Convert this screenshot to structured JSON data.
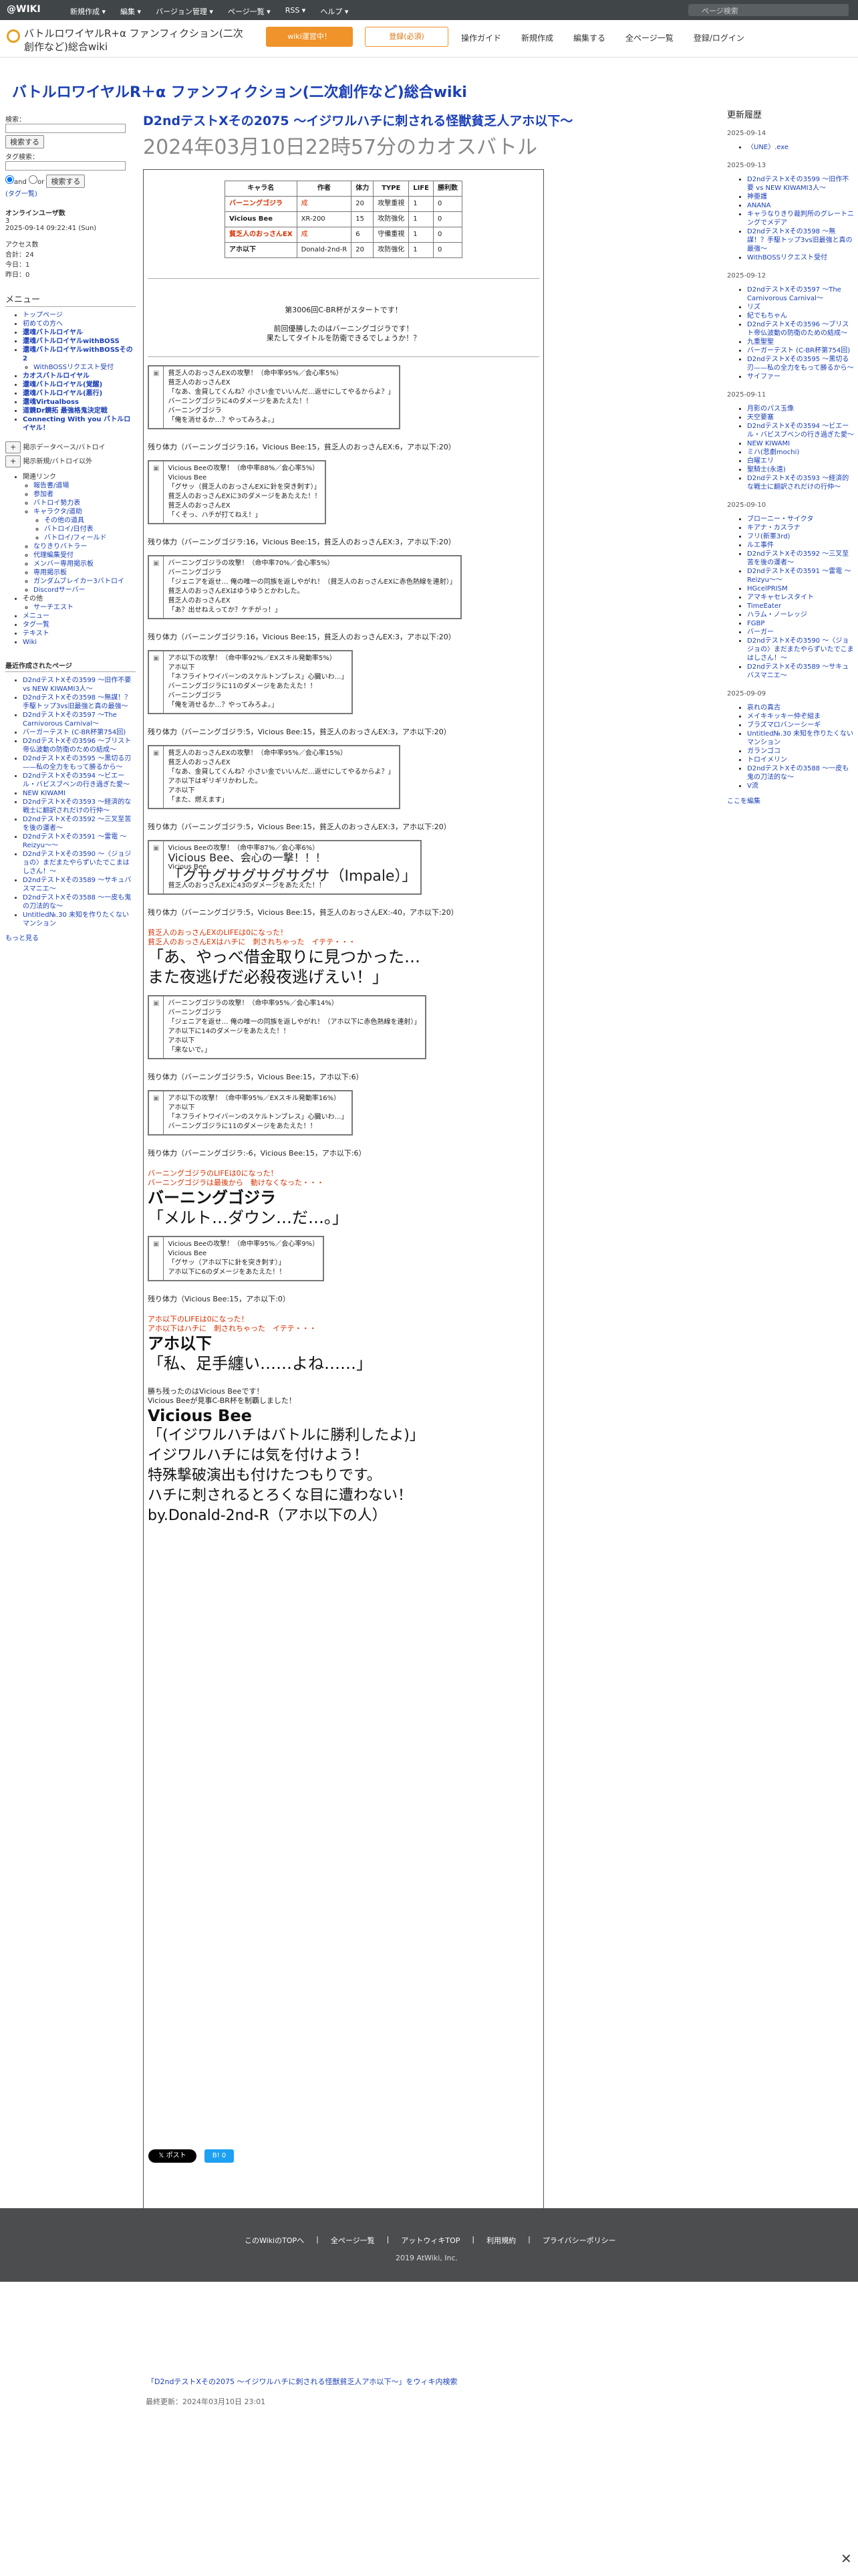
{
  "topbar": {
    "logo": "@WIKI",
    "menus": [
      "新規作成 ▾",
      "編集 ▾",
      "バージョン管理 ▾",
      "ページ一覧 ▾",
      "RSS ▾",
      "ヘルプ ▾"
    ],
    "search_placeholder": "ページ検索"
  },
  "header": {
    "site_name": "バトルロワイヤルR+α ファンフィクション(二次創作など)総合wiki",
    "btn_wiki": "wiki運営中！",
    "btn_register": "登録(必須)",
    "nav": [
      "操作ガイド",
      "新規作成",
      "編集する",
      "全ページ一覧",
      "登録/ログイン"
    ]
  },
  "site_title": "バトルロワイヤルR＋α ファンフィクション(二次創作など)総合wiki",
  "sidebar": {
    "search_label": "検索：",
    "search_button": "検索する",
    "tag_label": "タグ検索：",
    "radio_and": "and",
    "radio_or": "or",
    "tag_button": "検索する",
    "tag_list": "(タグ一覧)",
    "online_title": "オンラインユーザ数",
    "online_count": "3",
    "online_time": "2025-09-14 09:22:41 (Sun)",
    "access_title": "アクセス数",
    "access_total": "合計：24",
    "access_today": "今日：1",
    "access_yesterday": "昨日：0",
    "menu_title": "メニュー",
    "menu_items": [
      "トップページ",
      "初めての方へ",
      "還魂バトルロイヤル",
      "還魂バトルロイヤルwithBOSS",
      "還魂バトルロイヤルwithBOSSその2",
      "WithBOSSリクエスト受付",
      "カオスバトルロイヤル",
      "還魂バトルロイヤル(覚醒)",
      "還魂バトルロイヤル(悪行)",
      "還魂Virtualboss",
      "道鏡Dr鏡拓 最強格鬼決定戦",
      "Connecting With you バトルロイヤル！"
    ],
    "edit_buttons": [
      "掲示データベース/バトロイ",
      "掲示新規/バトロイ以外"
    ],
    "links_title": "関連リンク",
    "sub_items": [
      "報告書/道場",
      "参加者",
      "バトロイ勢力表",
      "キャラクタ/道助",
      "その他の道具",
      "バトロイ/日付表",
      "バトロイ/フィールド",
      "なりきりバトラー",
      "代理編集受付",
      "メンバー専用掲示板",
      "専用掲示板",
      "ガンダムブレイカー3バトロイ",
      "Discordサーバー"
    ],
    "other_title": "その他",
    "other_items": [
      "サーチエスト",
      "メニュー",
      "タグ一覧",
      "テキスト",
      "Wiki"
    ],
    "recent_title": "最近作成されたページ",
    "recent_items": [
      "D2ndテストXその3599 〜旧作不要 vs NEW KIWAMI3人〜",
      "D2ndテストXその3598 〜無謀！？手駆トップ3vs旧最強と真の最強〜",
      "D2ndテストXその3597 〜The Carnivorous Carnival〜",
      "バーガーテスト (C-BR杯第754回)",
      "D2ndテストXその3596 〜ブリスト帝仏波動の防衛のための結成〜",
      "D2ndテストXその3595 〜黒切る刃——私の全力をもって勝るから〜",
      "D2ndテストXその3594 〜ビエール・バビスブベンの行き過ぎた愛〜",
      "NEW KIWAMI",
      "D2ndテストXその3593 〜経済的な戦士に翻訳されだけの行仲〜",
      "D2ndテストXその3592 〜三叉至苦を後の運者〜",
      "D2ndテストXその3591 〜雷電 〜Reizyu〜〜",
      "D2ndテストXその3590 〜〈ジョジョの〉まだまたやらずいたでこまはしさん！〜",
      "D2ndテストXその3589 〜サキュバスマニエ〜",
      "D2ndテストXその3588 〜一皮も鬼の刀法的な〜",
      "Untitled№.30 未知を作りたくないマンション"
    ],
    "more": "もっと見る"
  },
  "main": {
    "page_title": "D2ndテストXその2075 〜イジワルハチに刺される怪獣貧乏人アホ以下〜",
    "subtitle": "2024年03月10日22時57分のカオスバトル",
    "footer_link": "「D2ndテストXその2075 〜イジワルハチに刺される怪獣貧乏人アホ以下〜」をウィキ内検索",
    "last_updated": "最終更新：2024年03月10日 23:01"
  },
  "roster": {
    "headers": [
      "キャラ名",
      "作者",
      "体力",
      "TYPE",
      "LIFE",
      "勝利数"
    ],
    "rows": [
      {
        "name": "バーニングゴジラ",
        "author": "成",
        "hp": "20",
        "type": "攻撃重視",
        "life": "1",
        "wins": "0"
      },
      {
        "name": "Vicious Bee",
        "author": "XR-200",
        "hp": "15",
        "type": "攻防強化",
        "life": "1",
        "wins": "0"
      },
      {
        "name": "貧乏人のおっさんEX",
        "author": "成",
        "hp": "6",
        "type": "守備重視",
        "life": "1",
        "wins": "0"
      },
      {
        "name": "アホ以下",
        "author": "Donald-2nd-R",
        "hp": "20",
        "type": "攻防強化",
        "life": "1",
        "wins": "0"
      }
    ]
  },
  "intro": {
    "line1": "第3006回C-BR杯がスタートです！",
    "line2": "前回優勝したのはバーニングゴジラです！",
    "line3": "果たしてタイトルを防衛できるでしょうか！？"
  },
  "battle": [
    {
      "type": "box",
      "lines": [
        "貧乏人のおっさんEXの攻撃！（命中率95%／会心率5%）",
        "貧乏人のおっさんEX",
        "「なあ、金貸してくんね？小さい金でいいんだ…返せにしてやるからよ？」",
        "バーニングゴジラに4のダメージをあたえた！！",
        "バーニングゴジラ",
        "「俺を消せるか…？やってみろよ。」"
      ]
    },
    {
      "type": "hp",
      "text": "残り体力（バーニングゴジラ:16，Vicious Bee:15，貧乏人のおっさんEX:6，アホ以下:20）"
    },
    {
      "type": "box",
      "lines": [
        "Vicious Beeの攻撃！（命中率88%／会心率5%）",
        "Vicious Bee",
        "「グサッ（貧乏人のおっさんEXに針を突き刺す）」",
        "貧乏人のおっさんEXに3のダメージをあたえた！！",
        "貧乏人のおっさんEX",
        "「くそっ、ハチが打てねえ！」"
      ]
    },
    {
      "type": "hp",
      "text": "残り体力（バーニングゴジラ:16，Vicious Bee:15，貧乏人のおっさんEX:3，アホ以下:20）"
    },
    {
      "type": "box",
      "lines": [
        "バーニングゴジラの攻撃！（命中率70%／会心率5%）",
        "バーニングゴジラ",
        "「ジェニアを返せ… 俺の唯一の同族を返しやがれ！（貧乏人のおっさんEXに赤色熱線を連射）」",
        "貧乏人のおっさんEXはゆうゆうとかわした。",
        "貧乏人のおっさんEX",
        "「あ？出せねえってか？ケチがっ！」"
      ]
    },
    {
      "type": "hp",
      "text": "残り体力（バーニングゴジラ:16，Vicious Bee:15，貧乏人のおっさんEX:3，アホ以下:20）"
    },
    {
      "type": "box",
      "lines": [
        "アホ以下の攻撃！（命中率92%／EXスキル発動率5%）",
        "アホ以下",
        "「ネフライトワイバーンのスケルトンブレス」心臓いわ…」",
        "バーニングゴジラに11のダメージをあたえた！！",
        "バーニングゴジラ",
        "「俺を消せるか…？やってみろよ。」"
      ]
    },
    {
      "type": "hp",
      "text": "残り体力（バーニングゴジラ:5，Vicious Bee:15，貧乏人のおっさんEX:3，アホ以下:20）"
    },
    {
      "type": "box",
      "lines": [
        "貧乏人のおっさんEXの攻撃！（命中率95%／会心率15%）",
        "貧乏人のおっさんEX",
        "「なあ、金貸してくんね？小さい金でいいんだ…返せにしてやるからよ？」",
        "アホ以下はギリギリかわした。",
        "アホ以下",
        "「また、燃えます」"
      ]
    },
    {
      "type": "hp",
      "text": "残り体力（バーニングゴジラ:5，Vicious Bee:15，貧乏人のおっさんEX:3，アホ以下:20）"
    },
    {
      "type": "box",
      "lines": [
        "Vicious Beeの攻撃！（命中率87%／会心率6%）",
        "Vicious Bee、会心の一撃！！！",
        "Vicious Bee",
        "「グサグサグサグサグサ（Impale）」",
        "貧乏人のおっさんEXに43のダメージをあたえた！！"
      ]
    },
    {
      "type": "hp",
      "text": "残り体力（バーニングゴジラ:5，Vicious Bee:15，貧乏人のおっさんEX:-40，アホ以下:20）"
    },
    {
      "type": "plain",
      "lines": [
        "貧乏人のおっさんEXのLIFEは0になった！",
        "貧乏人のおっさんEXはハチに　刺されちゃった　イテテ・・・",
        "「あ、やっべ借金取りに見つかった…",
        "また夜逃げだ必殺夜逃げえい！」"
      ]
    },
    {
      "type": "box",
      "lines": [
        "バーニングゴジラの攻撃！（命中率95%／会心率14%）",
        "バーニングゴジラ",
        "「ジェニアを返せ… 俺の唯一の同族を返しやがれ！（アホ以下に赤色熱線を連射）」",
        "アホ以下に14のダメージをあたえた！！",
        "アホ以下",
        "「来ないで。」"
      ]
    },
    {
      "type": "hp",
      "text": "残り体力（バーニングゴジラ:5，Vicious Bee:15，アホ以下:6）"
    },
    {
      "type": "box",
      "lines": [
        "アホ以下の攻撃！（命中率95%／EXスキル発動率16%）",
        "アホ以下",
        "「ネフライトワイバーンのスケルトンブレス」心臓いわ…」",
        "バーニングゴジラに11のダメージをあたえた！！"
      ]
    },
    {
      "type": "hp",
      "text": "残り体力（バーニングゴジラ:-6，Vicious Bee:15，アホ以下:6）"
    },
    {
      "type": "plain",
      "lines": [
        "バーニングゴジラのLIFEは0になった！",
        "バーニングゴジラは最後から　動けなくなった・・・",
        "バーニングゴジラ",
        "「メルト…ダウン…だ…。」"
      ]
    },
    {
      "type": "box",
      "lines": [
        "Vicious Beeの攻撃！（命中率95%／会心率9%）",
        "Vicious Bee",
        "「グサッ（アホ以下に針を突き刺す）」",
        "アホ以下に6のダメージをあたえた！！"
      ]
    },
    {
      "type": "hp",
      "text": "残り体力（Vicious Bee:15，アホ以下:0）"
    },
    {
      "type": "plain",
      "lines": [
        "アホ以下のLIFEは0になった！",
        "アホ以下はハチに　刺されちゃった　イテテ・・・",
        "アホ以下",
        "「私、足手纏い……よね……」"
      ]
    },
    {
      "type": "end",
      "lines": [
        "勝ち残ったのはVicious Beeです！",
        "Vicious Beeが見事C-BR杯を制覇しました！",
        "Vicious Bee",
        "「(イジワルハチはバトルに勝利したよ)」",
        "イジワルハチには気を付けよう！",
        "特殊撃破演出も付けたつもりです。",
        "ハチに刺されるとろくな目に遭わない！",
        "by.Donald-2nd-R（アホ以下の人）"
      ]
    }
  ],
  "updates": {
    "title": "更新履歴",
    "groups": [
      {
        "date": "2025-09-14",
        "items": [
          "〈UNE〉.exe"
        ]
      },
      {
        "date": "2025-09-13",
        "items": [
          "D2ndテストXその3599 〜旧作不要 vs NEW KIWAMI3人〜",
          "神亜護",
          "ANANA",
          "キャラなりきり裁判所のグレートニングでメデア",
          "D2ndテストXその3598 〜無謀！？手駆トップ3vs旧最強と真の最強〜",
          "WithBOSSリクエスト受付"
        ]
      },
      {
        "date": "2025-09-12",
        "items": [
          "D2ndテストXその3597 〜The Carnivorous Carnival〜",
          "リズ",
          "紀でもちゃん",
          "D2ndテストXその3596 〜ブリスト帝仏波動の防衛のための結成〜",
          "九重聖聖",
          "バーガーテスト (C-BR杯第754回)",
          "D2ndテストXその3595 〜黒切る刃——私の全力をもって勝るから〜",
          "サイファー"
        ]
      },
      {
        "date": "2025-09-11",
        "items": [
          "月影のパス玉像",
          "天空要塞",
          "D2ndテストXその3594 〜ビエール・バビスブベンの行き過ぎた愛〜",
          "NEW KIWAMI",
          "ミハ(悲劇mochi)",
          "白曜エリ",
          "聖騎士(永遠)",
          "D2ndテストXその3593 〜経済的な戦士に翻訳されだけの行仲〜"
        ]
      },
      {
        "date": "2025-09-10",
        "items": [
          "ブローニー・サイクタ",
          "キアナ・カスラナ",
          "フリ(新軍3rd)",
          "ルエ事件",
          "D2ndテストXその3592 〜三叉至苦を後の運者〜",
          "D2ndテストXその3591 〜雷電 〜Reizyu〜〜",
          "HGcelPRISM",
          "アマキャセレスタイト",
          "TimeEater",
          "ハラム・ノーレッジ",
          "FGBP",
          "バーガー",
          "D2ndテストXその3590 〜〈ジョジョの〉まだまたやらずいたでこまはしさん！〜",
          "D2ndテストXその3589 〜サキュバスマニエ〜"
        ]
      },
      {
        "date": "2025-09-09",
        "items": [
          "哀れの真古",
          "メイキキッキー仲ぞ組ま",
          "ブラズマロバンーシーギ",
          "Untitled№.30 未知を作りたくないマンション",
          "ガランゴコ",
          "トロイメリン",
          "D2ndテストXその3588 〜一皮も鬼の刀法的な〜",
          "V流"
        ]
      }
    ],
    "more": "ここを編集"
  },
  "share": {
    "x_post": "𝕏 ポスト",
    "bookmark": "B! 0"
  },
  "footer": {
    "links": [
      "このWikiのTOPへ",
      "全ページ一覧",
      "アットウィキTOP",
      "利用規約",
      "プライバシーポリシー"
    ],
    "copyright": "2019 AtWiki, Inc."
  }
}
